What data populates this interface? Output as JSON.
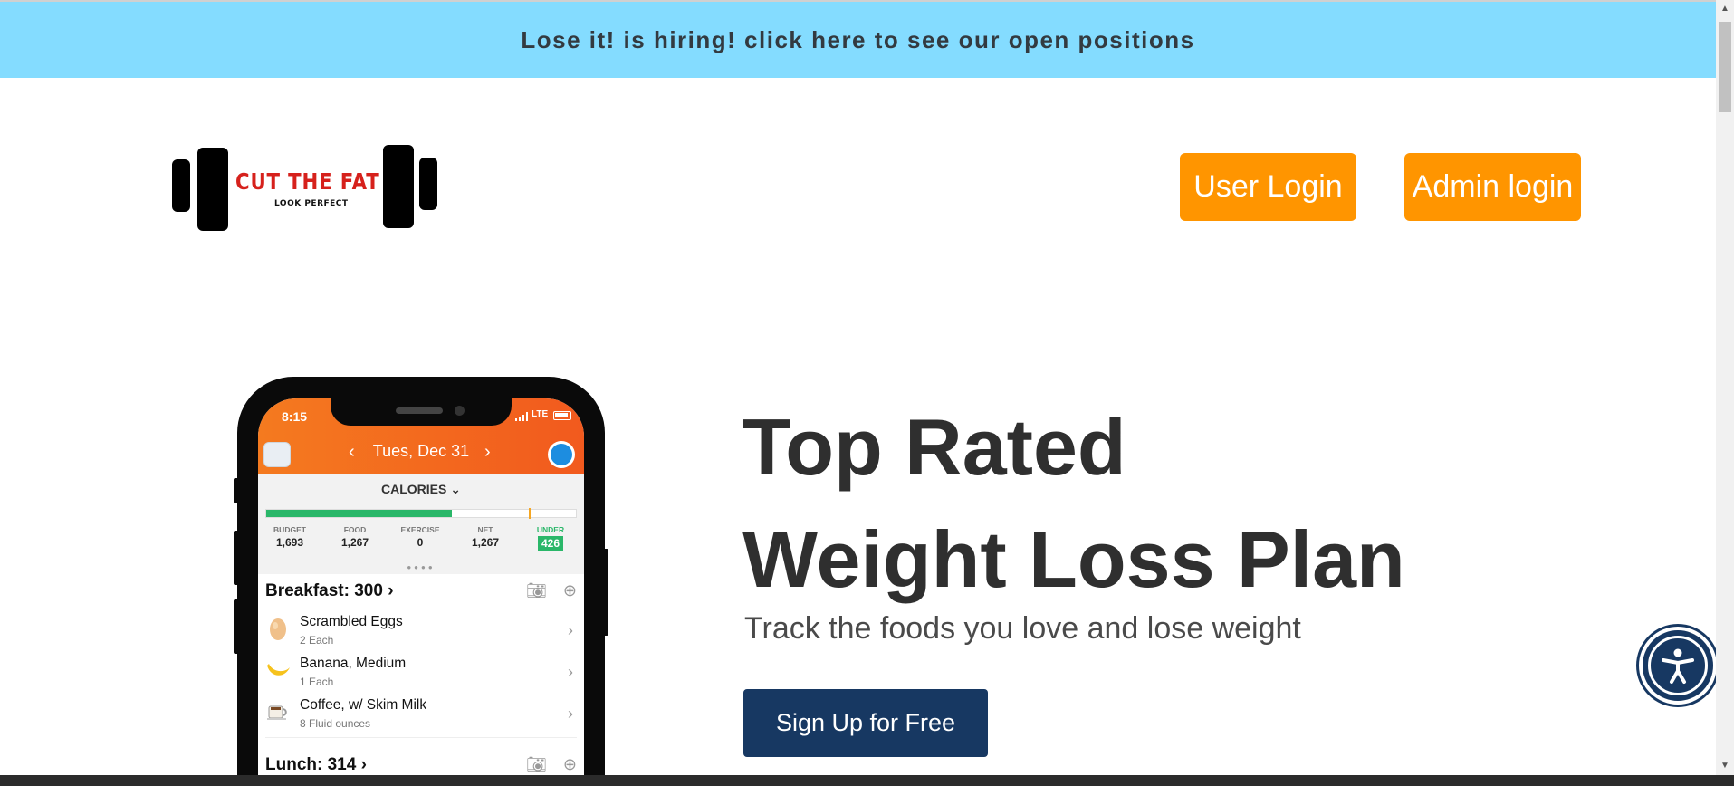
{
  "banner": {
    "text": "Lose it! is hiring! click here to see our open positions"
  },
  "logo": {
    "title": "CUT THE FAT",
    "tagline": "LOOK PERFECT"
  },
  "header": {
    "user_login_label": "User Login",
    "admin_login_label": "Admin login"
  },
  "hero": {
    "title_line1": "Top Rated",
    "title_line2": "Weight Loss Plan",
    "subtitle": "Track the foods you love and lose weight",
    "cta_label": "Sign Up for Free"
  },
  "phone_app": {
    "time": "8:15",
    "network": "LTE",
    "date": "Tues, Dec 31",
    "calories_label": "CALORIES",
    "progress_fraction": 0.6,
    "stats": [
      {
        "label": "BUDGET",
        "value": "1,693"
      },
      {
        "label": "FOOD",
        "value": "1,267"
      },
      {
        "label": "EXERCISE",
        "value": "0"
      },
      {
        "label": "NET",
        "value": "1,267"
      },
      {
        "label": "UNDER",
        "value": "426"
      }
    ],
    "breakfast": {
      "heading": "Breakfast: 300",
      "items": [
        {
          "name": "Scrambled Eggs",
          "qty": "2 Each",
          "icon": "egg-icon"
        },
        {
          "name": "Banana, Medium",
          "qty": "1 Each",
          "icon": "banana-icon"
        },
        {
          "name": "Coffee, w/ Skim Milk",
          "qty": "8 Fluid ounces",
          "icon": "coffee-icon"
        }
      ]
    },
    "lunch": {
      "heading": "Lunch: 314"
    }
  },
  "colors": {
    "banner_bg": "#84dcff",
    "login_button": "#ff9500",
    "signup_button": "#173862",
    "logo_red": "#d6211c",
    "app_orange": "#f47a1f",
    "app_green": "#2ab769"
  },
  "accessibility": {
    "icon": "accessibility-icon"
  }
}
